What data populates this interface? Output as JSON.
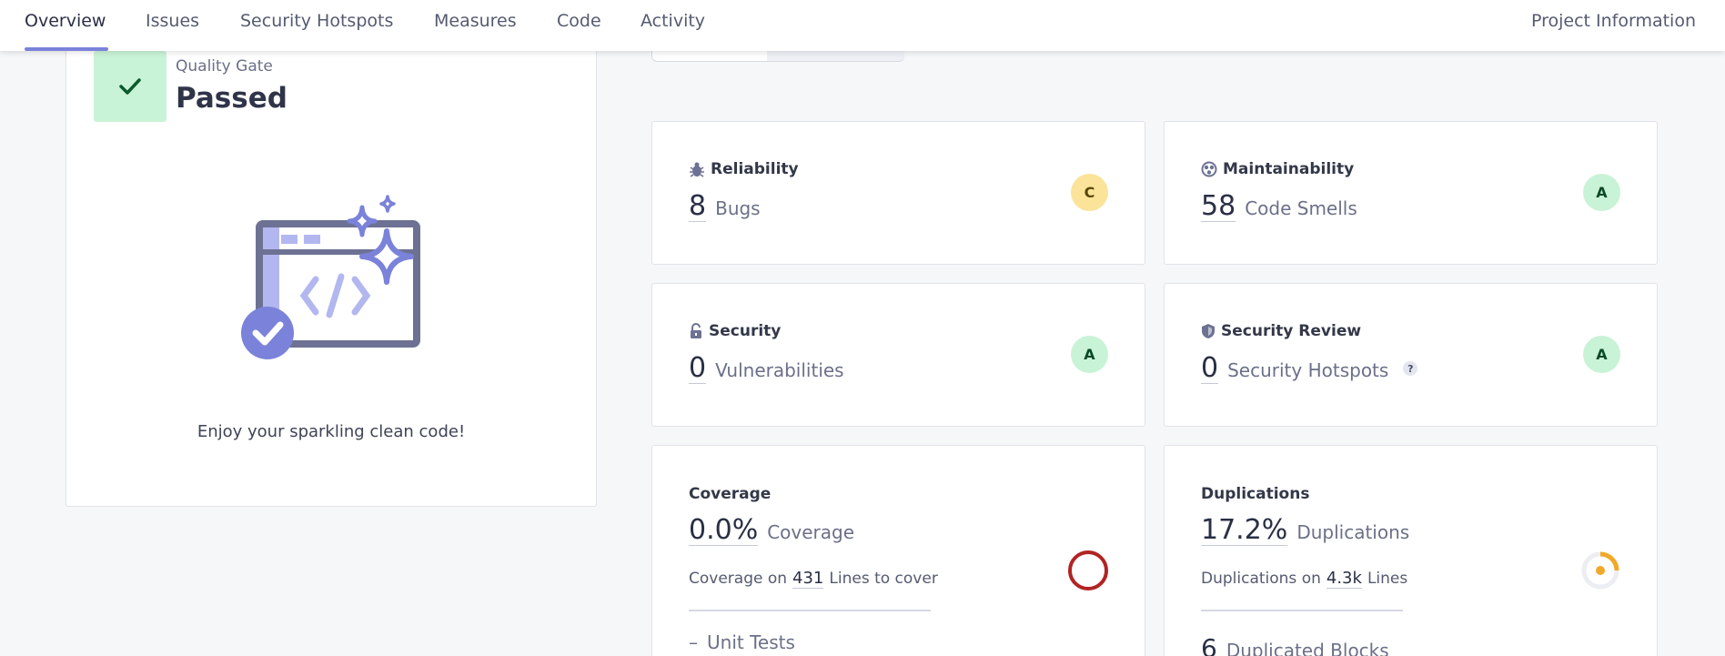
{
  "nav": {
    "tabs": [
      "Overview",
      "Issues",
      "Security Hotspots",
      "Measures",
      "Code",
      "Activity"
    ],
    "project_info": "Project Information"
  },
  "quality_gate": {
    "label": "Quality Gate",
    "status": "Passed",
    "message": "Enjoy your sparkling clean code!",
    "status_color": "#c9f3d6"
  },
  "reliability": {
    "title": "Reliability",
    "value": "8",
    "unit": "Bugs",
    "rating": "C",
    "icon": "bug-icon"
  },
  "maintainability": {
    "title": "Maintainability",
    "value": "58",
    "unit": "Code Smells",
    "rating": "A",
    "icon": "smell-icon"
  },
  "security": {
    "title": "Security",
    "value": "0",
    "unit": "Vulnerabilities",
    "rating": "A",
    "icon": "lock-icon"
  },
  "security_review": {
    "title": "Security Review",
    "value": "0",
    "unit": "Security Hotspots",
    "rating": "A",
    "help": "?",
    "icon": "shield-icon"
  },
  "coverage": {
    "title": "Coverage",
    "value": "0.0%",
    "unit": "Coverage",
    "sub_prefix": "Coverage on",
    "sub_value": "431",
    "sub_suffix": "Lines to cover",
    "unit_tests_dash": "–",
    "unit_tests_label": "Unit Tests",
    "ring_color": "#b22323"
  },
  "duplications": {
    "title": "Duplications",
    "value": "17.2%",
    "unit": "Duplications",
    "sub_prefix": "Duplications on",
    "sub_value": "4.3k",
    "sub_suffix": "Lines",
    "blocks_value": "6",
    "blocks_label": "Duplicated Blocks",
    "ring_color": "#f0a929"
  }
}
